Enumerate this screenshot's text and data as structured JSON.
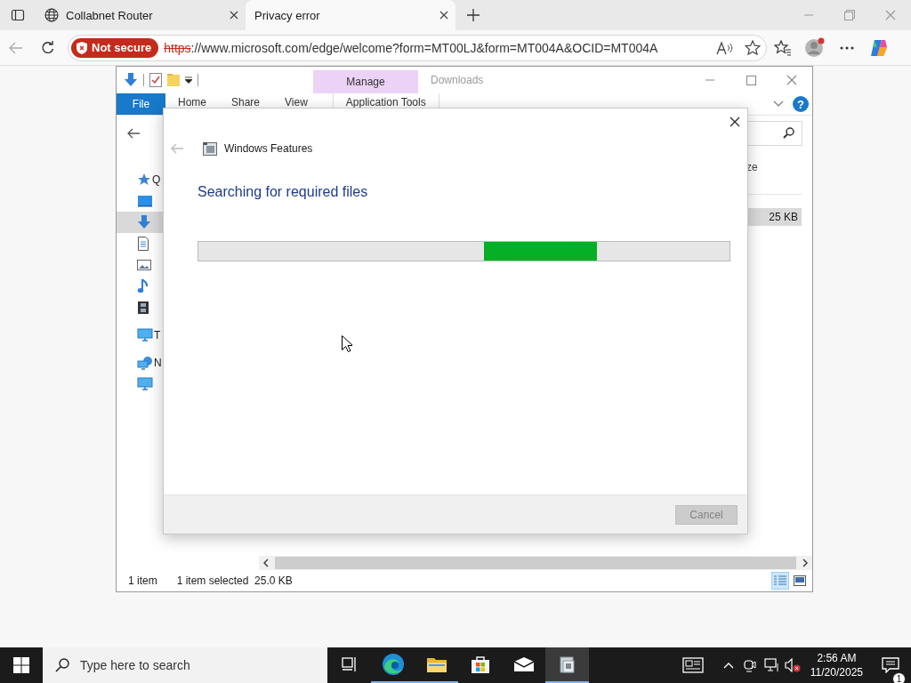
{
  "browser": {
    "tabs": [
      {
        "title": "Collabnet Router",
        "kind": "globe",
        "selected": false
      },
      {
        "title": "Privacy error",
        "kind": "plain",
        "selected": true
      }
    ],
    "address_bar": {
      "security_badge": "Not secure",
      "url_scheme": "https",
      "url_rest": "://www.microsoft.com/edge/welcome?form=MT00LJ&form=MT004A&OCID=MT004A"
    }
  },
  "explorer": {
    "window_title": "Downloads",
    "contextual_group": "Manage",
    "help": "?",
    "ribbon_tabs": [
      {
        "label": "File",
        "kind": "file"
      },
      {
        "label": "Home",
        "kind": "tab"
      },
      {
        "label": "Share",
        "kind": "tab"
      },
      {
        "label": "View",
        "kind": "tab"
      },
      {
        "label": "Application Tools",
        "kind": "contextual"
      }
    ],
    "nav_items": [
      {
        "kind": "quick_access",
        "label": "Q",
        "selected": false
      },
      {
        "kind": "desktop",
        "selected": false
      },
      {
        "kind": "downloads",
        "selected": true
      },
      {
        "kind": "documents",
        "selected": false
      },
      {
        "kind": "pictures",
        "selected": false
      },
      {
        "kind": "music",
        "selected": false
      },
      {
        "kind": "videos",
        "selected": false
      },
      {
        "kind": "this_pc",
        "label": "T",
        "selected": false
      },
      {
        "kind": "network",
        "label": "N",
        "selected": false
      },
      {
        "kind": "computer",
        "selected": false
      }
    ],
    "column_header": "ze",
    "rows": [
      {
        "size": "25 KB",
        "selected": true
      }
    ],
    "status": {
      "count": "1 item",
      "selection": "1 item selected  25.0 KB"
    },
    "view_buttons": [
      {
        "kind": "details",
        "selected": true
      },
      {
        "kind": "large_icons",
        "selected": false
      }
    ]
  },
  "dialog": {
    "title": "Windows Features",
    "heading": "Searching for required files",
    "progress": {
      "kind": "marquee"
    },
    "buttons": [
      {
        "label": "Cancel",
        "disabled": true
      }
    ]
  },
  "taskbar": {
    "search_placeholder": "Type here to search",
    "apps": [
      {
        "kind": "task_view",
        "running": false,
        "selected": false
      },
      {
        "kind": "edge",
        "running": true,
        "selected": false
      },
      {
        "kind": "folder",
        "running": true,
        "selected": false
      },
      {
        "kind": "store",
        "running": false,
        "selected": false
      },
      {
        "kind": "mail",
        "running": false,
        "selected": false
      },
      {
        "kind": "features",
        "running": true,
        "selected": true
      }
    ],
    "clock": {
      "time": "2:56 AM",
      "date": "11/20/2025"
    },
    "notification_count": "1"
  }
}
